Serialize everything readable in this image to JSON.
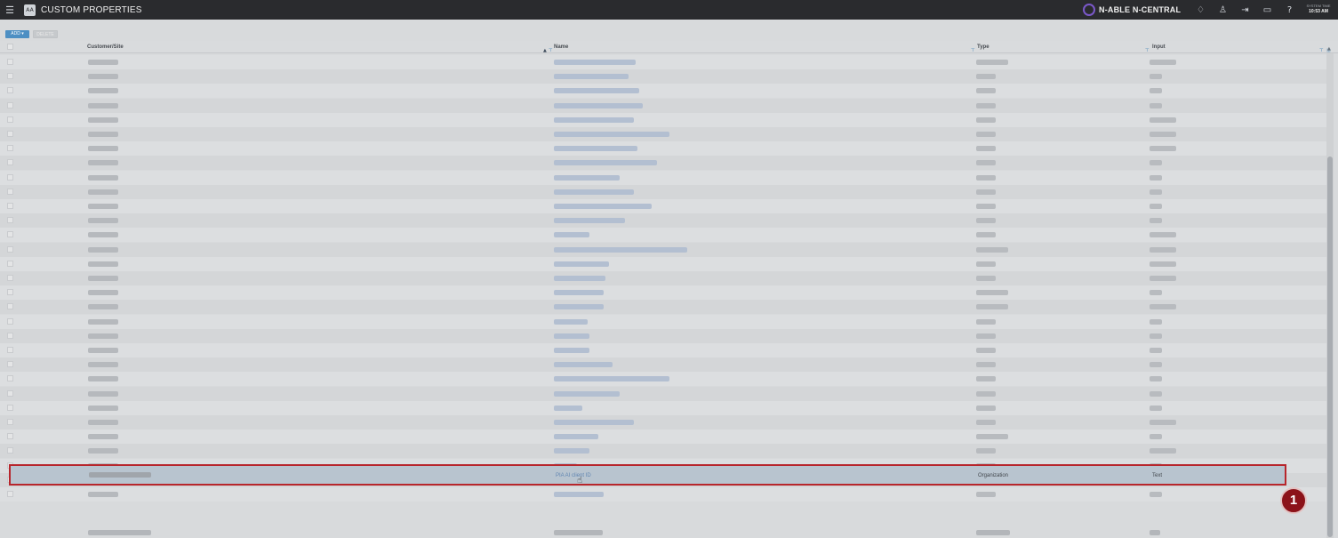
{
  "window": {
    "title": "CUSTOM PROPERTIES",
    "app_badge": "AA",
    "brand": "N-ABLE N-CENTRAL",
    "system_time_label": "SYSTEM TIME",
    "system_time_value": "10:53 AM"
  },
  "toolbar": {
    "add_label": "ADD ▾",
    "delete_label": "DELETE"
  },
  "columns": [
    {
      "key": "customer_site",
      "label": "Customer/Site"
    },
    {
      "key": "name",
      "label": "Name"
    },
    {
      "key": "type",
      "label": "Type"
    },
    {
      "key": "input",
      "label": "Input"
    }
  ],
  "highlighted_row": {
    "name": "PIA AI client ID",
    "type": "Organization",
    "input": "Text"
  },
  "annotation": {
    "callout_number": "1",
    "callout_color": "#8c1219",
    "border_color": "#b7262c"
  },
  "colors": {
    "accent": "#4d8fc3",
    "topbar": "#2a2b2e",
    "brand_mark": "#7a58c9"
  }
}
